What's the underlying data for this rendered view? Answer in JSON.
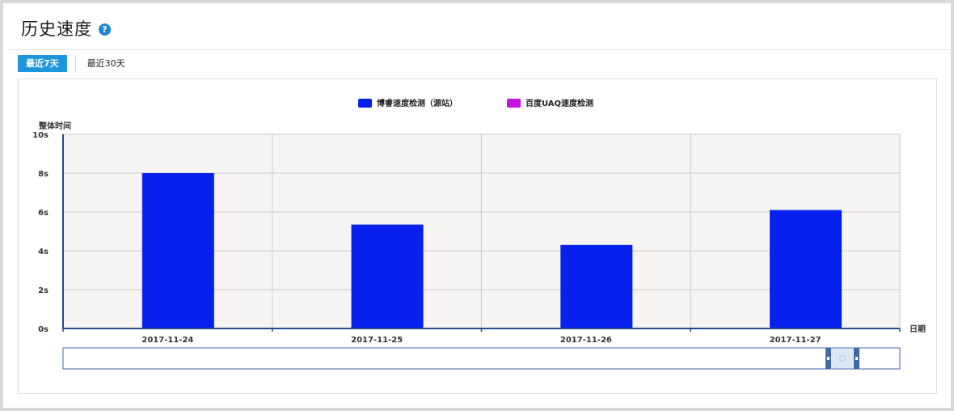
{
  "header": {
    "title": "历史速度",
    "help_icon": "question-circle-icon"
  },
  "tabs": [
    {
      "label": "最近7天",
      "active": true
    },
    {
      "label": "最近30天",
      "active": false
    }
  ],
  "colors": {
    "series_primary": "#0620ee",
    "series_secondary": "#c512e0",
    "tab_active": "#1e96dc",
    "axis": "#1f4e8a",
    "plot_bg": "#f6f5f4",
    "grid": "#c9c9c9"
  },
  "chart_data": {
    "type": "bar",
    "ylabel": "整体时间",
    "xlabel": "日期",
    "ylim": [
      0,
      10
    ],
    "y_ticks": [
      "0s",
      "2s",
      "4s",
      "6s",
      "8s",
      "10s"
    ],
    "y_tick_values": [
      0,
      2,
      4,
      6,
      8,
      10
    ],
    "categories": [
      "2017-11-24",
      "2017-11-25",
      "2017-11-26",
      "2017-11-27"
    ],
    "series": [
      {
        "name": "博睿速度检测（源站）",
        "color": "#0620ee",
        "values": [
          8.0,
          5.35,
          4.3,
          6.1
        ]
      },
      {
        "name": "百度UAQ速度检测",
        "color": "#c512e0",
        "values": [
          null,
          null,
          null,
          null
        ]
      }
    ],
    "legend_position": "top-center",
    "grid": true
  }
}
